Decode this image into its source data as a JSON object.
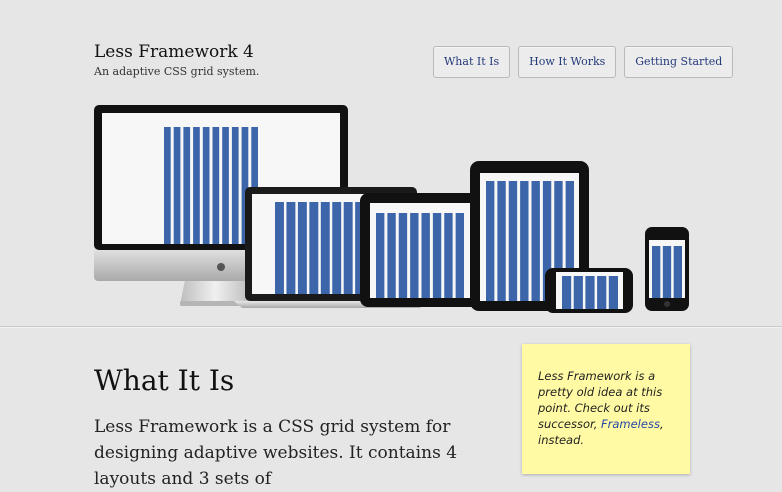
{
  "header": {
    "title": "Less Framework 4",
    "tagline": "An adaptive CSS grid system."
  },
  "nav": {
    "items": [
      {
        "label": "What It Is"
      },
      {
        "label": "How It Works"
      },
      {
        "label": "Getting Started"
      }
    ]
  },
  "hero": {
    "devices": [
      "desktop-monitor-icon",
      "laptop-icon",
      "tablet-landscape-icon",
      "tablet-portrait-icon",
      "phone-landscape-icon",
      "phone-portrait-icon"
    ],
    "column_color": "#3d66aa"
  },
  "main": {
    "heading": "What It Is",
    "intro": "Less Framework is a CSS grid system for designing adaptive websites. It contains 4 layouts and 3 sets of"
  },
  "note": {
    "text_before": "Less Framework is a pretty old idea at this point. Check out its successor, ",
    "link_label": "Frameless",
    "text_after": ", instead."
  }
}
